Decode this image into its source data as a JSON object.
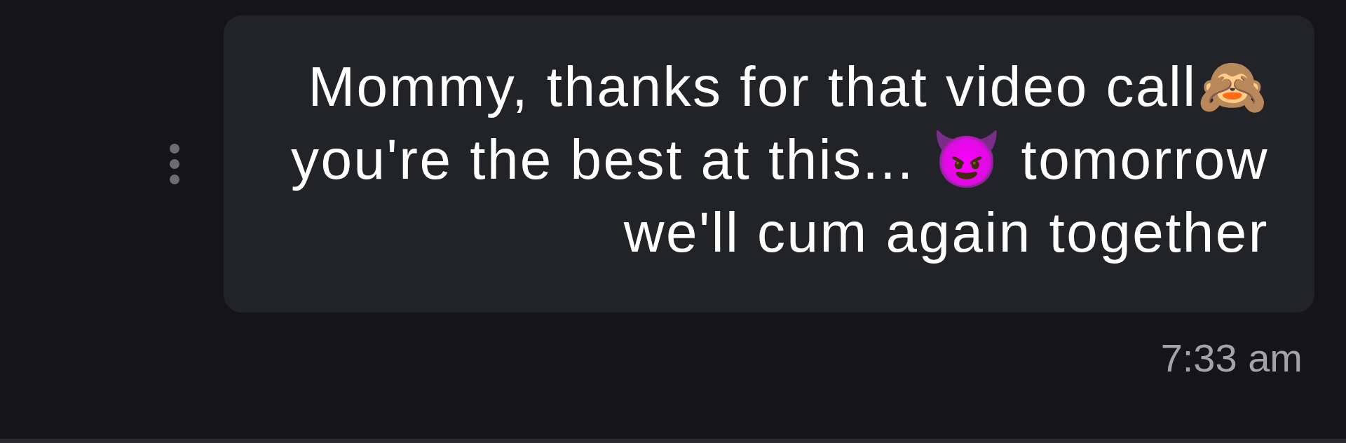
{
  "message": {
    "text": "Mommy, thanks for that video call🙈 you're the best at this... 😈 tomorrow we'll cum again together",
    "time": "7:33 am"
  }
}
